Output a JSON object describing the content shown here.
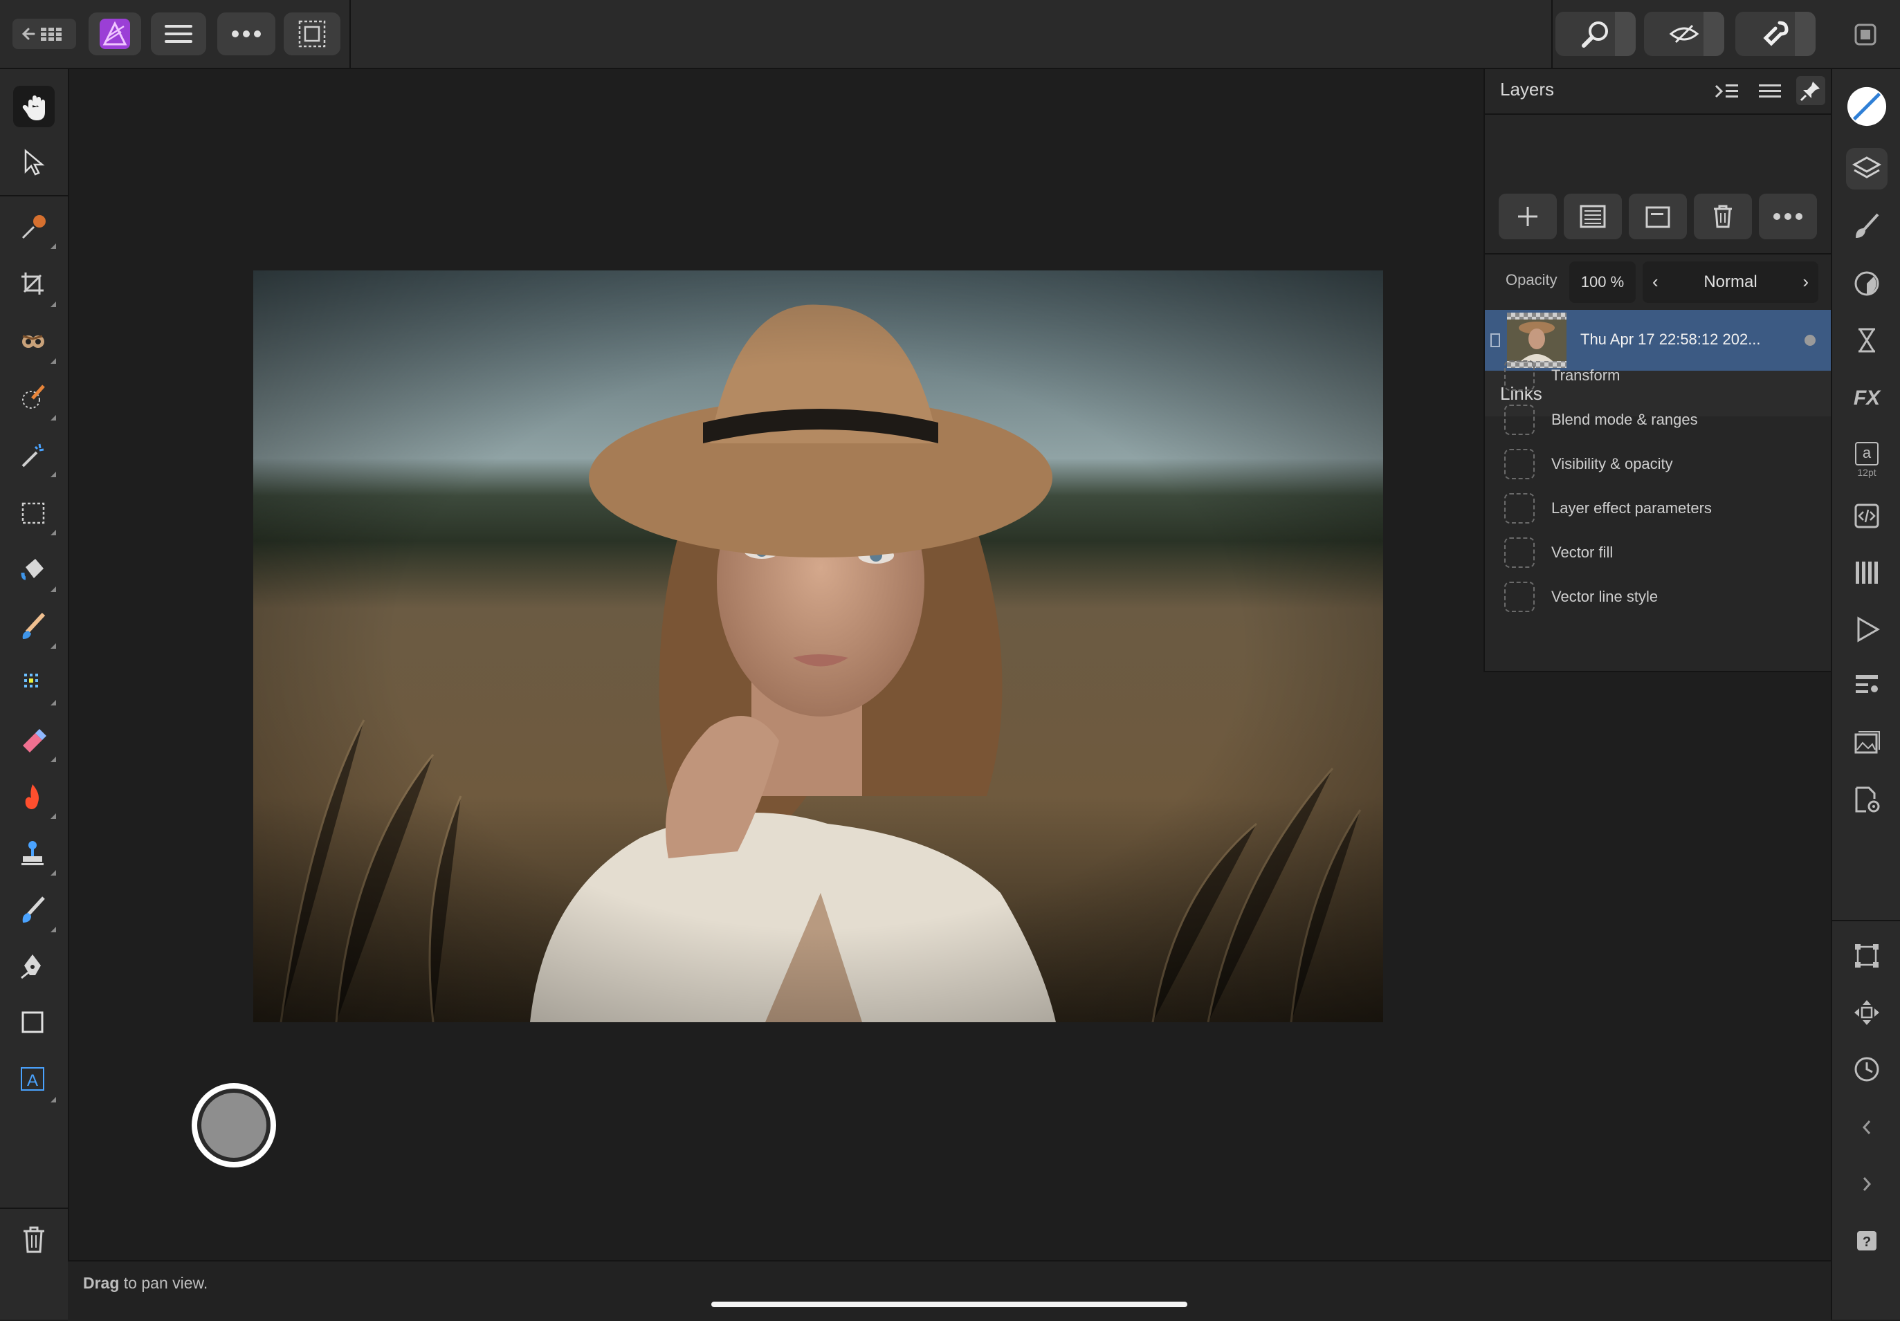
{
  "toolbar": {
    "back_grid_label": "",
    "app_icon": "affinity-photo-icon",
    "menu_icon": "hamburger-icon",
    "more_icon": "ellipsis-icon",
    "selection_icon": "marquee-selection-icon",
    "zoom_icon": "loupe-icon",
    "view_icon": "view-mode-icon",
    "snap_icon": "snapping-magnet-icon",
    "window_icon": "window-icon"
  },
  "left_tools": [
    {
      "name": "view-hand-tool-icon",
      "active": true
    },
    {
      "name": "move-tool-icon"
    },
    {
      "name": "color-picker-tool-icon"
    },
    {
      "name": "crop-tool-icon"
    },
    {
      "name": "red-eye-tool-icon"
    },
    {
      "name": "selection-brush-tool-icon"
    },
    {
      "name": "magic-wand-tool-icon"
    },
    {
      "name": "rectangular-marquee-tool-icon"
    },
    {
      "name": "flood-fill-tool-icon"
    },
    {
      "name": "paint-brush-tool-icon"
    },
    {
      "name": "pixel-tool-icon"
    },
    {
      "name": "erase-brush-tool-icon"
    },
    {
      "name": "burn-tool-icon"
    },
    {
      "name": "clone-stamp-tool-icon"
    },
    {
      "name": "healing-brush-tool-icon"
    },
    {
      "name": "pen-tool-icon"
    },
    {
      "name": "rectangle-tool-icon"
    },
    {
      "name": "artistic-text-tool-icon"
    }
  ],
  "layers_panel": {
    "title": "Layers",
    "opacity_label": "Opacity",
    "opacity_value": "100 %",
    "blend_mode": "Normal",
    "layer_name": "Thu Apr 17 22:58:12 202...",
    "links_title": "Links",
    "links": [
      "Transform",
      "Blend mode & ranges",
      "Visibility & opacity",
      "Layer effect parameters",
      "Vector fill",
      "Vector line style"
    ]
  },
  "right_studio": {
    "text_style_size": "12pt"
  },
  "status": {
    "bold": "Drag",
    "rest": " to pan view."
  },
  "colors": {
    "accent_selected_layer": "#3c5a83",
    "app_icon_purple": "#a855f7"
  }
}
